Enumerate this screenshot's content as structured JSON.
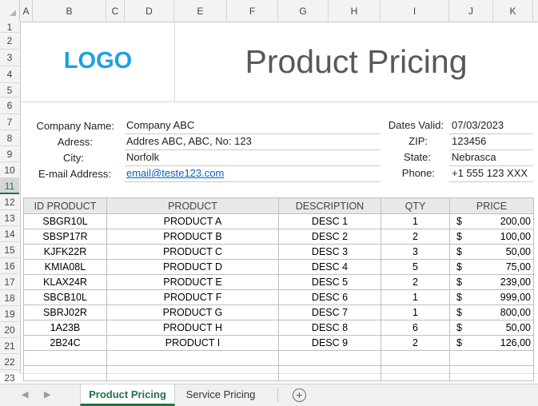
{
  "columns": [
    "A",
    "B",
    "C",
    "D",
    "E",
    "F",
    "G",
    "H",
    "I",
    "J",
    "K"
  ],
  "rows": [
    "1",
    "2",
    "3",
    "4",
    "5",
    "6",
    "7",
    "8",
    "9",
    "10",
    "11",
    "12",
    "13",
    "14",
    "15",
    "16",
    "17",
    "18",
    "19",
    "20",
    "21",
    "22",
    "23"
  ],
  "selected_row": "11",
  "logo_text": "LOGO",
  "title": "Product Pricing",
  "company": {
    "name_label": "Company Name:",
    "name_value": "Company ABC",
    "address_label": "Adress:",
    "address_value": "Addres ABC, ABC, No: 123",
    "city_label": "City:",
    "city_value": "Norfolk",
    "email_label": "E-mail Address:",
    "email_value": "email@teste123.com"
  },
  "info": {
    "dates_label": "Dates Valid:",
    "dates_value": "07/03/2023",
    "zip_label": "ZIP:",
    "zip_value": "123456",
    "state_label": "State:",
    "state_value": "Nebrasca",
    "phone_label": "Phone:",
    "phone_value": "+1 555 123 XXX"
  },
  "table": {
    "headers": {
      "id": "ID PRODUCT",
      "product": "PRODUCT",
      "description": "DESCRIPTION",
      "qty": "QTY",
      "price": "PRICE"
    },
    "rows": [
      {
        "id": "SBGR10L",
        "product": "PRODUCT A",
        "desc": "DESC 1",
        "qty": "1",
        "cur": "$",
        "price": "200,00"
      },
      {
        "id": "SBSP17R",
        "product": "PRODUCT B",
        "desc": "DESC 2",
        "qty": "2",
        "cur": "$",
        "price": "100,00"
      },
      {
        "id": "KJFK22R",
        "product": "PRODUCT C",
        "desc": "DESC 3",
        "qty": "3",
        "cur": "$",
        "price": "50,00"
      },
      {
        "id": "KMIA08L",
        "product": "PRODUCT D",
        "desc": "DESC 4",
        "qty": "5",
        "cur": "$",
        "price": "75,00"
      },
      {
        "id": "KLAX24R",
        "product": "PRODUCT E",
        "desc": "DESC 5",
        "qty": "2",
        "cur": "$",
        "price": "239,00"
      },
      {
        "id": "SBCB10L",
        "product": "PRODUCT F",
        "desc": "DESC 6",
        "qty": "1",
        "cur": "$",
        "price": "999,00"
      },
      {
        "id": "SBRJ02R",
        "product": "PRODUCT G",
        "desc": "DESC 7",
        "qty": "1",
        "cur": "$",
        "price": "800,00"
      },
      {
        "id": "1A23B",
        "product": "PRODUCT H",
        "desc": "DESC 8",
        "qty": "6",
        "cur": "$",
        "price": "50,00"
      },
      {
        "id": "2B24C",
        "product": "PRODUCT I",
        "desc": "DESC 9",
        "qty": "2",
        "cur": "$",
        "price": "126,00"
      },
      {
        "id": "",
        "product": "",
        "desc": "",
        "qty": "",
        "cur": "",
        "price": ""
      },
      {
        "id": "",
        "product": "",
        "desc": "",
        "qty": "",
        "cur": "",
        "price": ""
      }
    ]
  },
  "sheet_tabs": [
    {
      "label": "Product Pricing",
      "active": true
    },
    {
      "label": "Service Pricing",
      "active": false
    }
  ],
  "colors": {
    "accent": "#217346",
    "logo": "#1ba1e2",
    "link": "#0563c1"
  },
  "icons": {
    "nav_prev": "chevron-left-icon",
    "nav_next": "chevron-right-icon",
    "add_sheet": "plus-circle-icon",
    "select_all": "select-all-triangle-icon"
  }
}
